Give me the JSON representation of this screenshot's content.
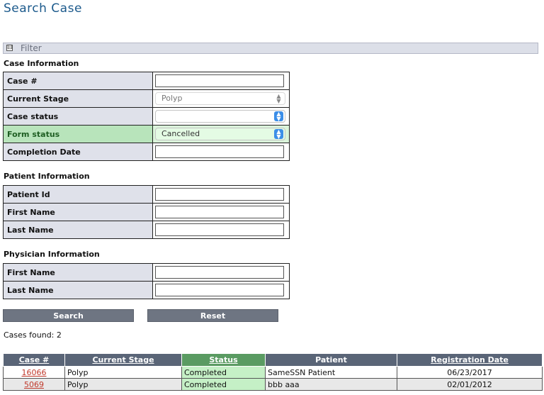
{
  "page": {
    "title": "Search Case"
  },
  "filter": {
    "label": "Filter",
    "toggle_symbol": "⊟"
  },
  "case_info": {
    "title": "Case Information",
    "case_no_label": "Case #",
    "case_no_value": "",
    "current_stage_label": "Current Stage",
    "current_stage_value": "Polyp",
    "case_status_label": "Case status",
    "case_status_value": "",
    "form_status_label": "Form status",
    "form_status_value": "Cancelled",
    "completion_date_label": "Completion Date",
    "completion_date_value": ""
  },
  "patient_info": {
    "title": "Patient Information",
    "patient_id_label": "Patient Id",
    "first_name_label": "First Name",
    "last_name_label": "Last Name"
  },
  "physician_info": {
    "title": "Physician Information",
    "first_name_label": "First Name",
    "last_name_label": "Last Name"
  },
  "buttons": {
    "search": "Search",
    "reset": "Reset"
  },
  "results": {
    "summary": "Cases found: 2",
    "headers": {
      "case_no": "Case #",
      "current_stage": "Current Stage",
      "status": "Status",
      "patient": "Patient",
      "registration_date": "Registration Date"
    },
    "rows": [
      {
        "case_no": "16066",
        "current_stage": "Polyp",
        "status": "Completed",
        "patient": "SameSSN Patient",
        "registration_date": "06/23/2017"
      },
      {
        "case_no": "5069",
        "current_stage": "Polyp",
        "status": "Completed",
        "patient": "bbb aaa",
        "registration_date": "02/01/2012"
      }
    ]
  }
}
